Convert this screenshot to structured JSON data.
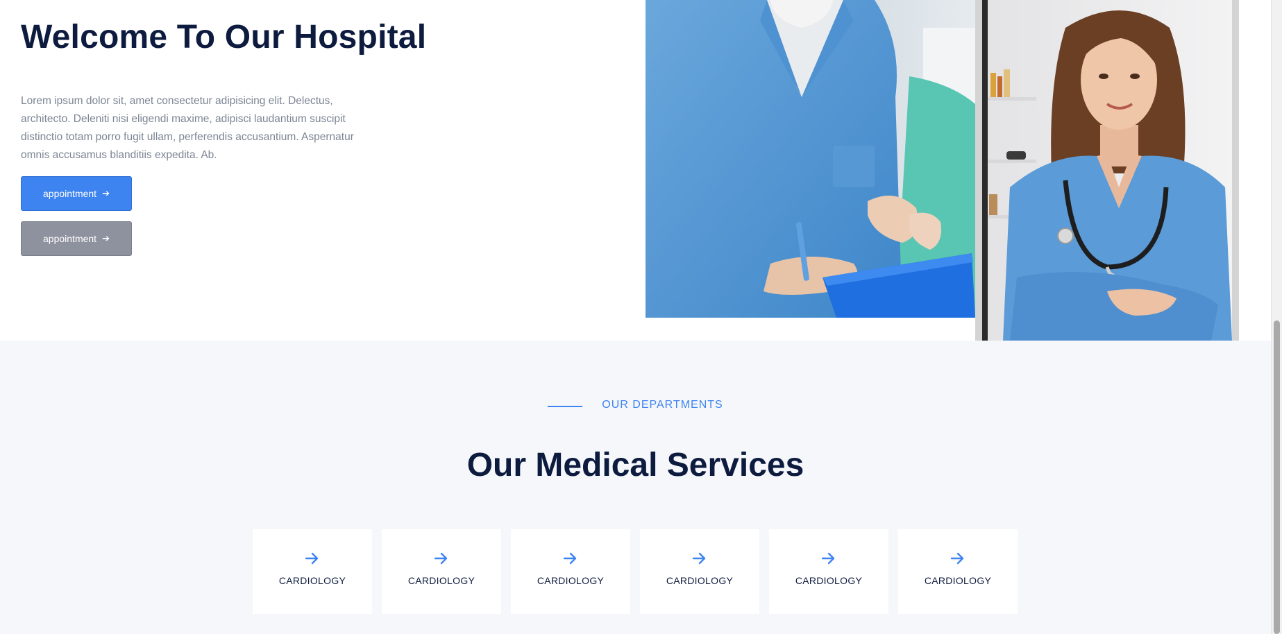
{
  "hero": {
    "title": "Welcome To Our Hospital",
    "text": "Lorem ipsum dolor sit, amet consectetur adipisicing elit. Delectus, architecto. Deleniti nisi eligendi maxime, adipisci laudantium suscipit distinctio totam porro fugit ullam, perferendis accusantium. Aspernatur omnis accusamus blanditiis expedita. Ab.",
    "primary_button": "appointment",
    "secondary_button": "appointment",
    "button_icon": "arrow-right-icon"
  },
  "services": {
    "eyebrow": "OUR DEPARTMENTS",
    "title": "Our Medical Services",
    "cards": [
      {
        "label": "CARDIOLOGY",
        "icon": "arrow-right-icon"
      },
      {
        "label": "CARDIOLOGY",
        "icon": "arrow-right-icon"
      },
      {
        "label": "CARDIOLOGY",
        "icon": "arrow-right-icon"
      },
      {
        "label": "CARDIOLOGY",
        "icon": "arrow-right-icon"
      },
      {
        "label": "CARDIOLOGY",
        "icon": "arrow-right-icon"
      },
      {
        "label": "CARDIOLOGY",
        "icon": "arrow-right-icon"
      }
    ]
  },
  "colors": {
    "accent": "#3d84f0",
    "heading": "#0d1b3e",
    "secondary_button": "#8e929e",
    "section_bg": "#f5f7fb"
  }
}
